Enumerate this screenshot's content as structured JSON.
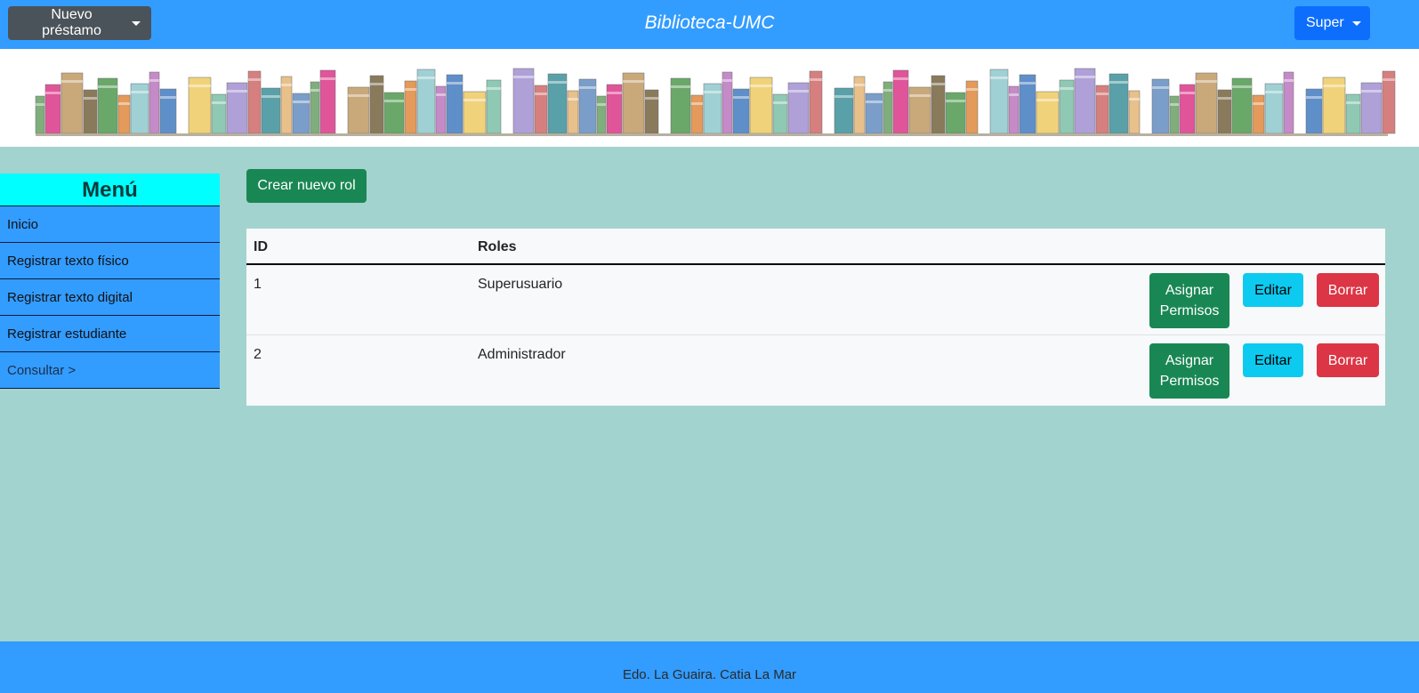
{
  "navbar": {
    "loan_label": "Nuevo préstamo",
    "brand": "Biblioteca-UMC",
    "user_label": "Super"
  },
  "sidebar": {
    "title": "Menú",
    "items": [
      {
        "label": "Inicio"
      },
      {
        "label": "Registrar texto físico"
      },
      {
        "label": "Registrar texto digital"
      },
      {
        "label": "Registrar estudiante"
      },
      {
        "label": "Consultar >"
      }
    ]
  },
  "main": {
    "create_label": "Crear nuevo rol",
    "table": {
      "headers": [
        "ID",
        "Roles"
      ],
      "rows": [
        {
          "id": "1",
          "role": "Superusuario"
        },
        {
          "id": "2",
          "role": "Administrador"
        }
      ],
      "actions": {
        "assign_line1": "Asignar",
        "assign_line2": "Permisos",
        "edit": "Editar",
        "delete": "Borrar"
      }
    }
  },
  "footer": {
    "text": "Edo. La Guaira. Catia La Mar"
  },
  "colors": {
    "navbar": "#339cff",
    "background": "#a3d3cf",
    "menu_title": "#00ffff",
    "success": "#198754",
    "info": "#0dcaf0",
    "danger": "#dc3545",
    "primary": "#0d6efd",
    "secondary": "#4b535a"
  }
}
